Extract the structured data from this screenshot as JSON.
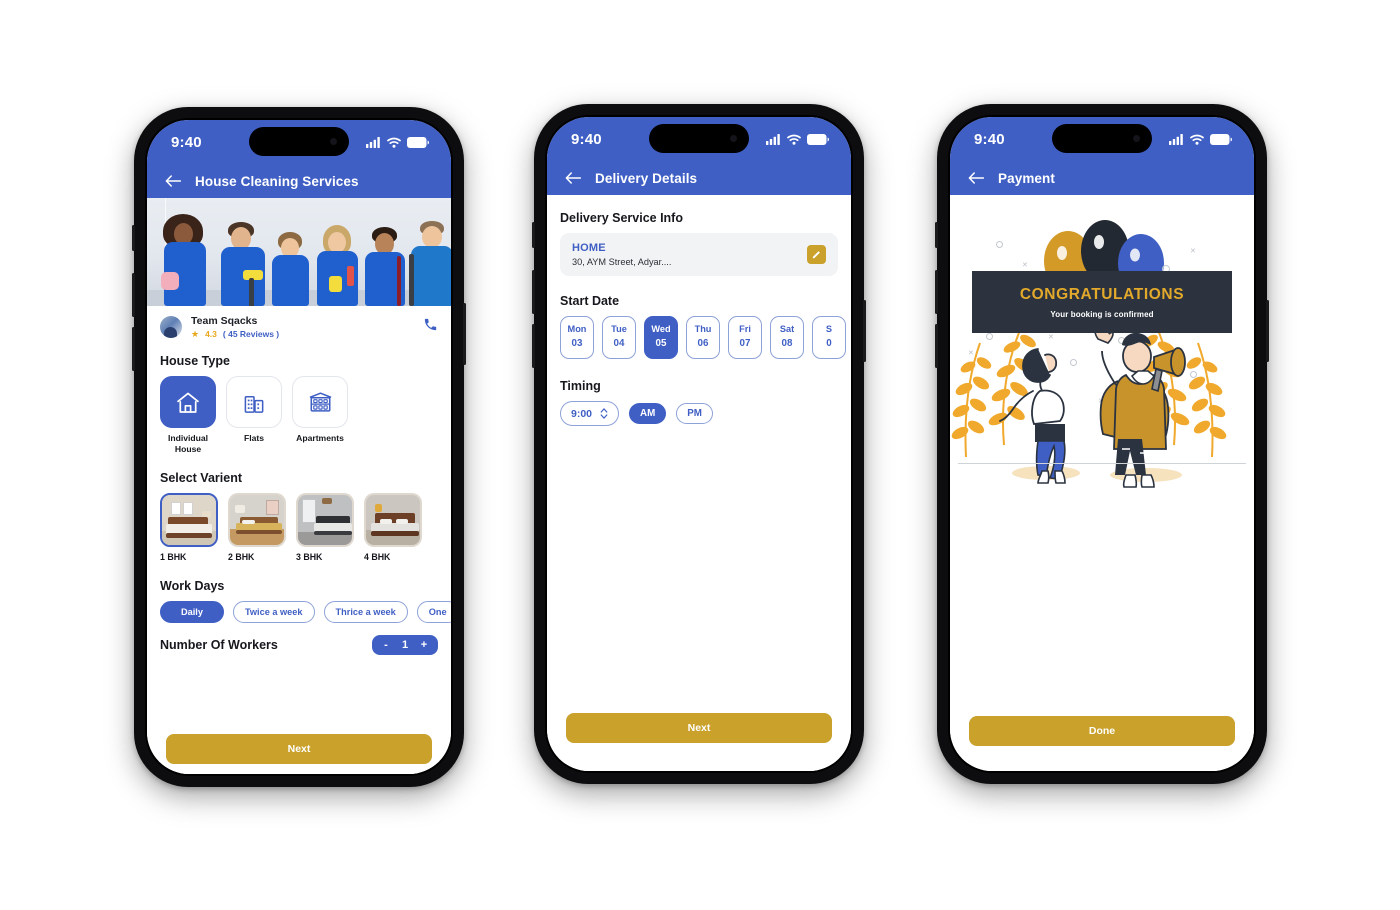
{
  "app": {
    "blue": "#3f5fc4",
    "gold": "#c9a12b",
    "dark": "#2c333e"
  },
  "status_bar": {
    "time": "9:40",
    "icons": [
      "signal-icon",
      "wifi-icon",
      "battery-icon"
    ]
  },
  "screen1": {
    "appbar": {
      "back": "back-arrow-icon",
      "title": "House Cleaning Services"
    },
    "hero_alt": "cleaning-team-photo",
    "provider": {
      "name": "Team Sqacks",
      "star": "★",
      "rating": "4.3",
      "reviews": "( 45 Reviews )",
      "call_icon": "phone-icon"
    },
    "house_type": {
      "title": "House Type",
      "options": [
        {
          "label": "Individual House",
          "icon": "house-icon",
          "selected": true
        },
        {
          "label": "Flats",
          "icon": "buildings-icon",
          "selected": false
        },
        {
          "label": "Apartments",
          "icon": "apartment-icon",
          "selected": false
        }
      ]
    },
    "variant": {
      "title": "Select Varient",
      "options": [
        {
          "label": "1 BHK",
          "selected": true
        },
        {
          "label": "2 BHK",
          "selected": false
        },
        {
          "label": "3 BHK",
          "selected": false
        },
        {
          "label": "4 BHK",
          "selected": false
        }
      ]
    },
    "work_days": {
      "title": "Work Days",
      "options": [
        {
          "label": "Daily",
          "selected": true
        },
        {
          "label": "Twice a week",
          "selected": false
        },
        {
          "label": "Thrice a week",
          "selected": false
        },
        {
          "label": "One",
          "selected": false
        }
      ]
    },
    "workers": {
      "title": "Number Of Workers",
      "minus": "-",
      "count": "1",
      "plus": "+"
    },
    "cta": "Next"
  },
  "screen2": {
    "appbar": {
      "back": "back-arrow-icon",
      "title": "Delivery Details"
    },
    "service_info": {
      "title": "Delivery Service Info",
      "label": "HOME",
      "address": "30, AYM Street, Adyar....",
      "edit_icon": "pencil-icon"
    },
    "start_date": {
      "title": "Start Date",
      "dates": [
        {
          "day": "Mon",
          "num": "03",
          "selected": false
        },
        {
          "day": "Tue",
          "num": "04",
          "selected": false
        },
        {
          "day": "Wed",
          "num": "05",
          "selected": true
        },
        {
          "day": "Thu",
          "num": "06",
          "selected": false
        },
        {
          "day": "Fri",
          "num": "07",
          "selected": false
        },
        {
          "day": "Sat",
          "num": "08",
          "selected": false
        },
        {
          "day": "S",
          "num": "0",
          "selected": false
        }
      ]
    },
    "timing": {
      "title": "Timing",
      "time": "9:00",
      "stepper_icon": "chevron-updown-icon",
      "am": "AM",
      "pm": "PM",
      "selected": "AM"
    },
    "cta": "Next"
  },
  "screen3": {
    "appbar": {
      "back": "back-arrow-icon",
      "title": "Payment"
    },
    "celebration": {
      "headline": "CONGRATULATIONS",
      "subtext": "Your booking is confirmed",
      "art": "celebrating-people-illustration"
    },
    "cta": "Done"
  }
}
